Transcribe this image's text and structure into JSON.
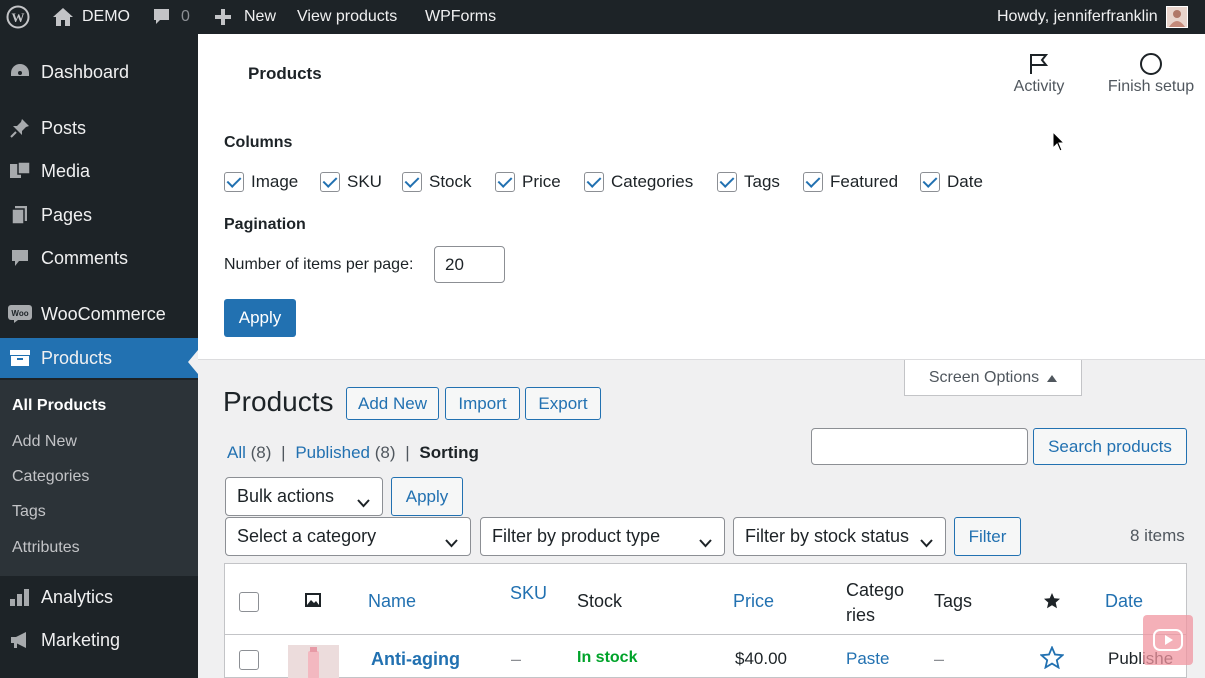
{
  "adminbar": {
    "site_name": "DEMO",
    "comments_count": "0",
    "new_label": "New",
    "view_products": "View products",
    "wpforms": "WPForms",
    "howdy": "Howdy, jenniferfranklin"
  },
  "sidebar": {
    "items": [
      {
        "label": "Dashboard",
        "icon": "dashboard-icon"
      },
      {
        "label": "Posts",
        "icon": "pin-icon"
      },
      {
        "label": "Media",
        "icon": "media-icon"
      },
      {
        "label": "Pages",
        "icon": "pages-icon"
      },
      {
        "label": "Comments",
        "icon": "comment-icon"
      },
      {
        "label": "WooCommerce",
        "icon": "woo-icon"
      },
      {
        "label": "Products",
        "icon": "archive-icon"
      },
      {
        "label": "Analytics",
        "icon": "bar-chart-icon"
      },
      {
        "label": "Marketing",
        "icon": "megaphone-icon"
      }
    ],
    "submenu": [
      "All Products",
      "Add New",
      "Categories",
      "Tags",
      "Attributes"
    ]
  },
  "header": {
    "title": "Products",
    "activity": "Activity",
    "finish_setup": "Finish setup"
  },
  "screen_options": {
    "columns_heading": "Columns",
    "columns": [
      {
        "label": "Image",
        "checked": true
      },
      {
        "label": "SKU",
        "checked": true
      },
      {
        "label": "Stock",
        "checked": true
      },
      {
        "label": "Price",
        "checked": true
      },
      {
        "label": "Categories",
        "checked": true
      },
      {
        "label": "Tags",
        "checked": true
      },
      {
        "label": "Featured",
        "checked": true
      },
      {
        "label": "Date",
        "checked": true
      }
    ],
    "pagination_heading": "Pagination",
    "per_page_label": "Number of items per page:",
    "per_page_value": "20",
    "apply": "Apply",
    "tab_label": "Screen Options"
  },
  "main": {
    "title": "Products",
    "add_new": "Add New",
    "import": "Import",
    "export": "Export",
    "views": {
      "all": "All",
      "all_count": "(8)",
      "published": "Published",
      "published_count": "(8)",
      "sorting": "Sorting"
    },
    "search_button": "Search products",
    "bulk_actions": "Bulk actions",
    "bulk_apply": "Apply",
    "select_category": "Select a category",
    "filter_type": "Filter by product type",
    "filter_stock": "Filter by stock status",
    "filter_button": "Filter",
    "items_count": "8 items"
  },
  "table": {
    "headers": {
      "name": "Name",
      "sku": "SKU",
      "stock": "Stock",
      "price": "Price",
      "categories_line1": "Catego",
      "categories_line2": "ries",
      "tags": "Tags",
      "date": "Date"
    },
    "rows": [
      {
        "name": "Anti-aging",
        "sku": "–",
        "stock": "In stock",
        "price": "$40.00",
        "category": "Paste",
        "tags": "–",
        "date": "Publishe"
      }
    ]
  },
  "colors": {
    "accent": "#2271b1",
    "admin_dark": "#1d2327",
    "in_stock": "#00a32a"
  }
}
